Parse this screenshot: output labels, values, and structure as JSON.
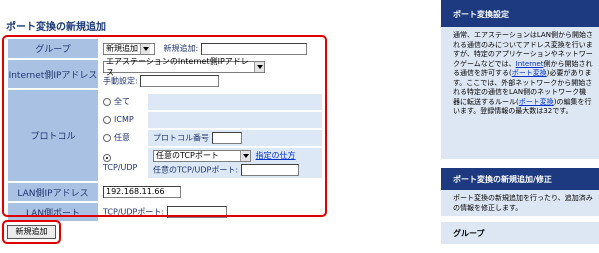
{
  "title": "ポート変換の新規追加",
  "form": {
    "group": {
      "label": "グループ",
      "select_value": "新規追加",
      "new_label": "新規追加:",
      "new_value": ""
    },
    "internet_ip": {
      "label": "Internet側IPアドレス",
      "select_value": "エアステーションのInternet側IPアドレス",
      "manual_label": "手動設定:",
      "manual_value": ""
    },
    "protocol": {
      "label": "プロトコル",
      "options": [
        "全て",
        "ICMP",
        "任意",
        "TCP/UDP"
      ],
      "selected": "TCP/UDP",
      "protocol_number_label": "プロトコル番号",
      "protocol_number_value": "",
      "tcp_select_value": "任意のTCPポート",
      "howto_link": "指定の仕方",
      "port_label": "任意のTCP/UDPポート:",
      "port_value": ""
    },
    "lan_ip": {
      "label": "LAN側IPアドレス",
      "value": "192.168.11.66"
    },
    "lan_port": {
      "label": "LAN側ポート",
      "port_label": "TCP/UDPポート:",
      "value": ""
    }
  },
  "submit_label": "新規追加",
  "sidebar": {
    "section1_title": "ポート変換設定",
    "section1_text_a": "通常、エアステーションはLAN側から開始される通信のみについてアドレス変換を行いますが、特定のアプリケーションやネットワークゲームなどでは、",
    "section1_link_a": "Internet",
    "section1_text_b": "側から開始される通信を許可する(",
    "section1_link_b": "ポート変換",
    "section1_text_c": ")必要があります。ここでは、外部ネットワークから開始される特定の通信をLAN側のネットワーク機器に転送するルール(",
    "section1_link_c": "ポート変換",
    "section1_text_d": ")の編集を行います。登録情報の最大数は32です。",
    "section2_title": "ポート変換の新規追加/修正",
    "section2_text": "ポート変換の新規追加を行ったり、追加済みの情報を修正します。",
    "section3_title": "グループ"
  }
}
